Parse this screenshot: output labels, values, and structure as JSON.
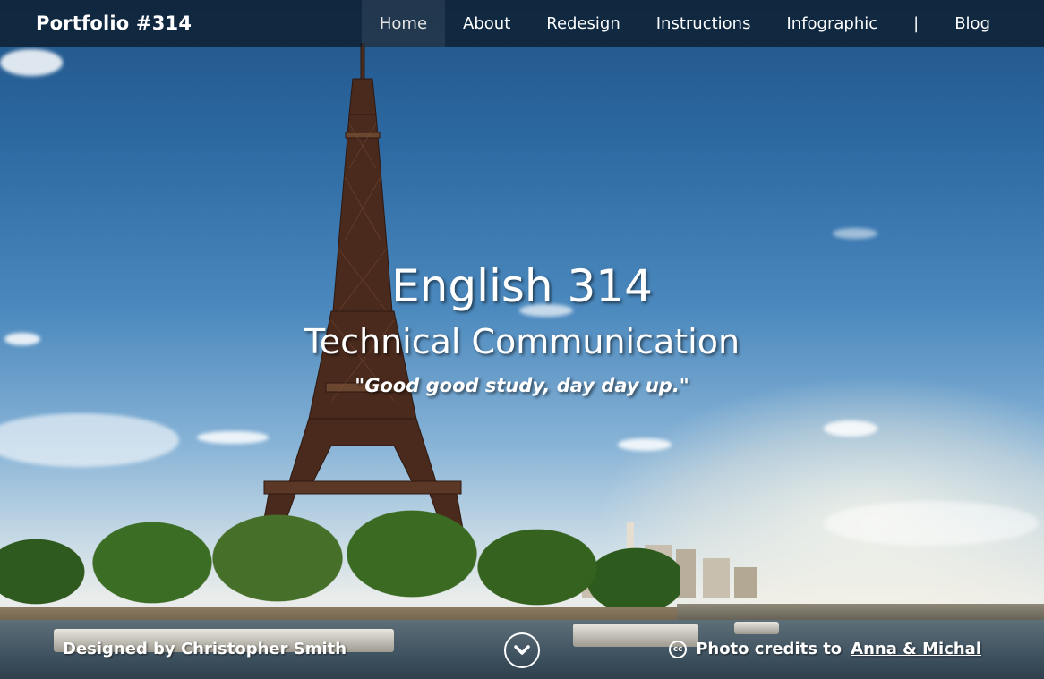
{
  "header": {
    "brand": "Portfolio #314",
    "nav": [
      {
        "label": "Home"
      },
      {
        "label": "About"
      },
      {
        "label": "Redesign"
      },
      {
        "label": "Instructions"
      },
      {
        "label": "Infographic"
      },
      {
        "label": "Blog"
      }
    ],
    "separator": "|"
  },
  "hero": {
    "title": "English 314",
    "subtitle": "Technical Communication",
    "quote": "\"Good good study, day day up.\""
  },
  "footer": {
    "designed_by": "Designed by Christopher Smith",
    "photo_credits_prefix": "Photo credits to",
    "photo_credits_link": "Anna & Michal",
    "cc_icon": "creative-commons-icon",
    "scroll_icon": "chevron-down-icon"
  }
}
